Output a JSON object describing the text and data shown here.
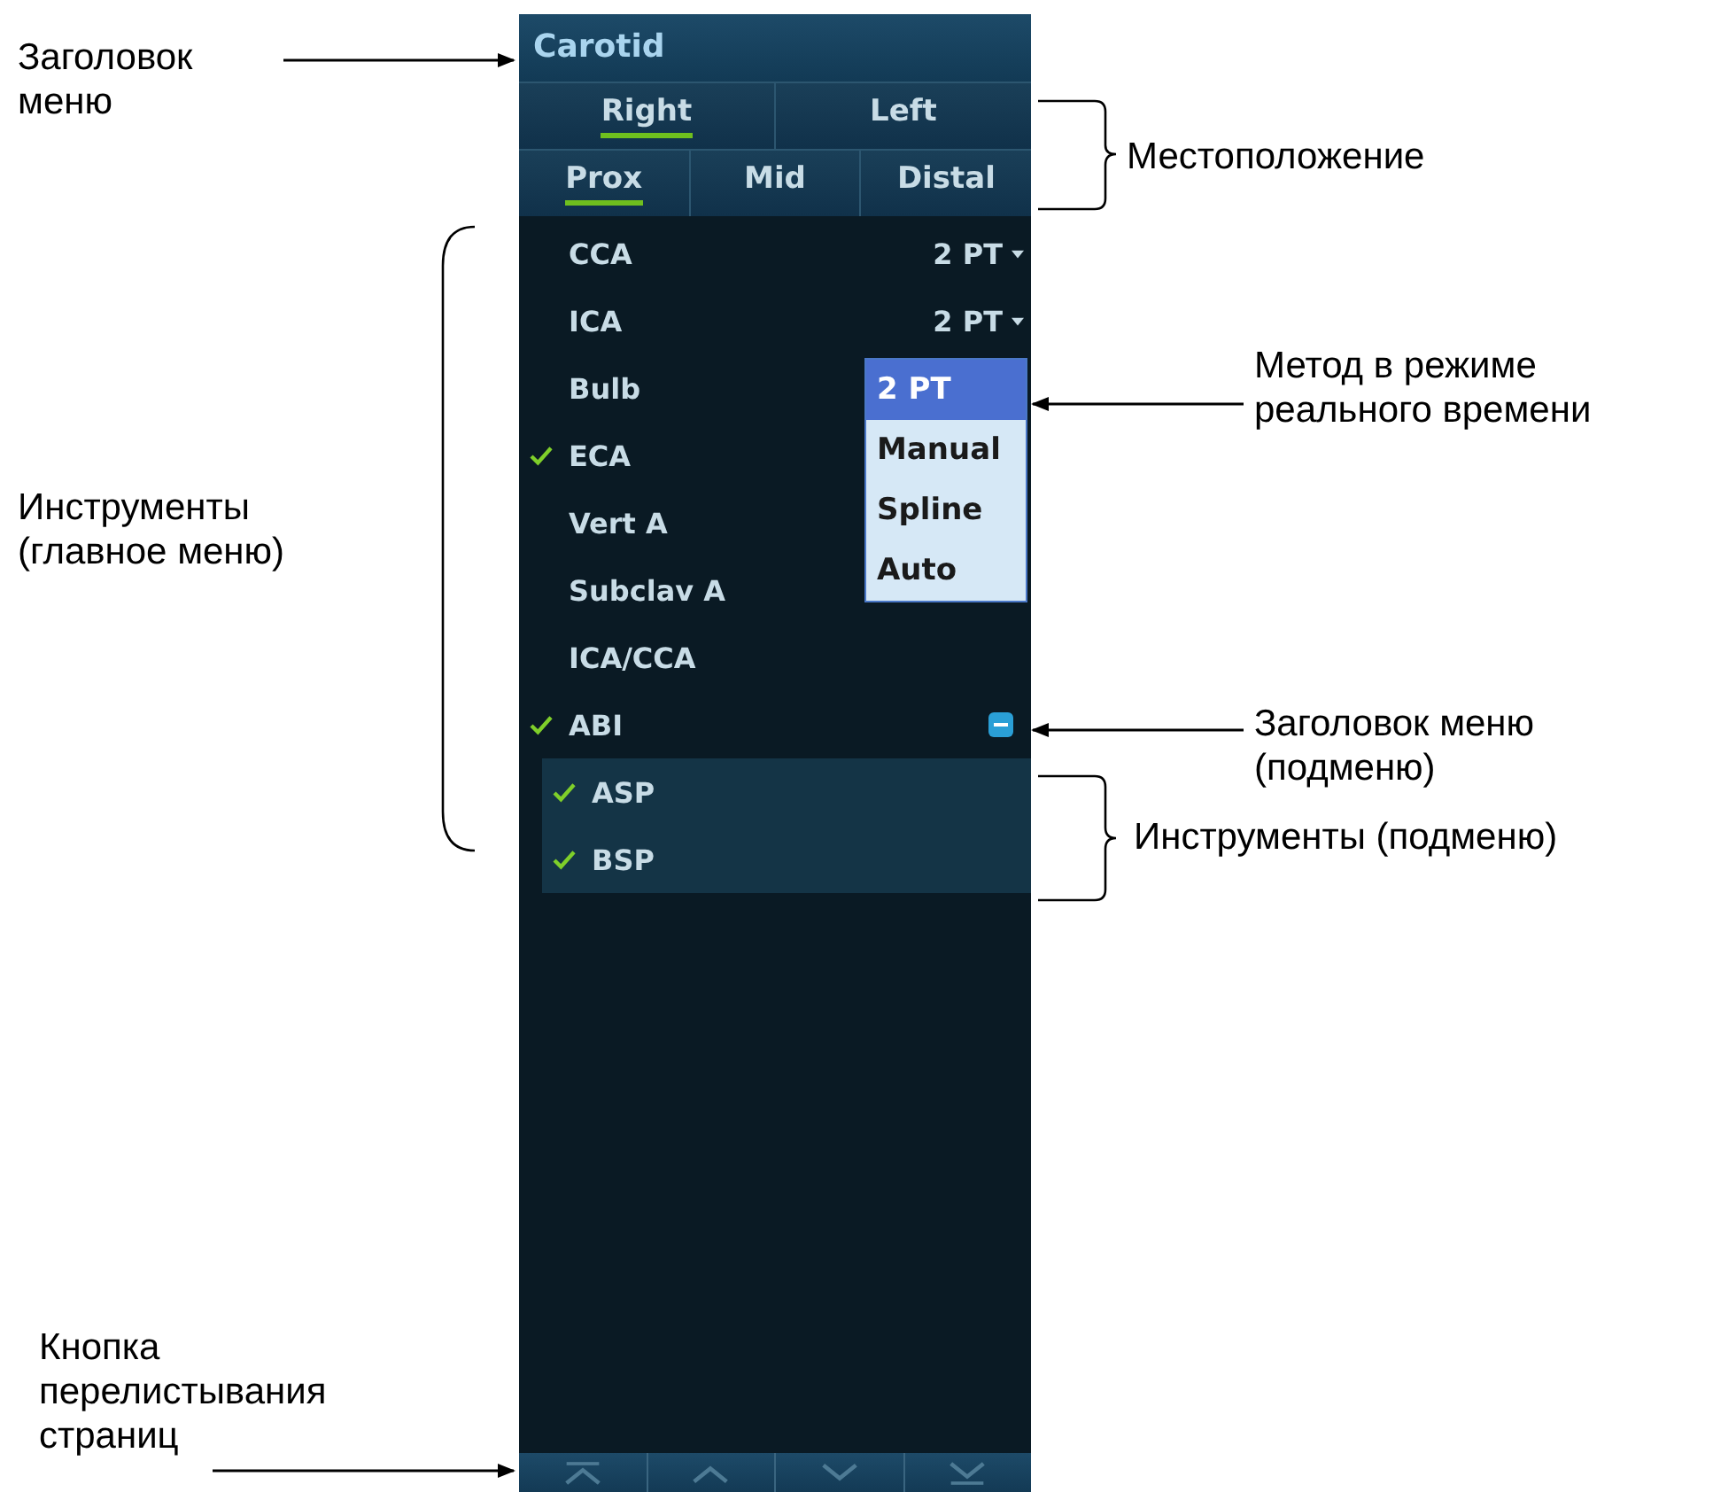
{
  "menu_title": "Carotid",
  "side_tabs": [
    {
      "label": "Right",
      "selected": true
    },
    {
      "label": "Left",
      "selected": false
    }
  ],
  "segment_tabs": [
    {
      "label": "Prox",
      "selected": true
    },
    {
      "label": "Mid",
      "selected": false
    },
    {
      "label": "Distal",
      "selected": false
    }
  ],
  "tools": [
    {
      "label": "CCA",
      "checked": false,
      "method": "2 PT"
    },
    {
      "label": "ICA",
      "checked": false,
      "method": "2 PT"
    },
    {
      "label": "Bulb",
      "checked": false,
      "method_menu": [
        {
          "label": "2 PT",
          "selected": true
        },
        {
          "label": "Manual",
          "selected": false
        },
        {
          "label": "Spline",
          "selected": false
        },
        {
          "label": "Auto",
          "selected": false
        }
      ]
    },
    {
      "label": "ECA",
      "checked": true
    },
    {
      "label": "Vert A",
      "checked": false
    },
    {
      "label": "Subclav A",
      "checked": false
    },
    {
      "label": "ICA/CCA",
      "checked": false
    },
    {
      "label": "ABI",
      "checked": true,
      "expanded": true,
      "children": [
        {
          "label": "ASP",
          "checked": true
        },
        {
          "label": "BSP",
          "checked": true
        }
      ]
    }
  ],
  "annotations": [
    {
      "kind": "arrow",
      "lines": [
        "Заголовок",
        "меню"
      ]
    },
    {
      "kind": "bracket",
      "lines": [
        "Местоположение"
      ]
    },
    {
      "kind": "arrow",
      "lines": [
        "Метод в режиме",
        "реального времени"
      ]
    },
    {
      "kind": "bracket",
      "lines": [
        "Инструменты",
        "(главное меню)"
      ]
    },
    {
      "kind": "arrow",
      "lines": [
        "Заголовок меню",
        "(подменю)"
      ]
    },
    {
      "kind": "bracket",
      "lines": [
        "Инструменты (подменю)"
      ]
    },
    {
      "kind": "arrow",
      "lines": [
        "Кнопка",
        "перелистывания",
        "страниц"
      ]
    }
  ]
}
